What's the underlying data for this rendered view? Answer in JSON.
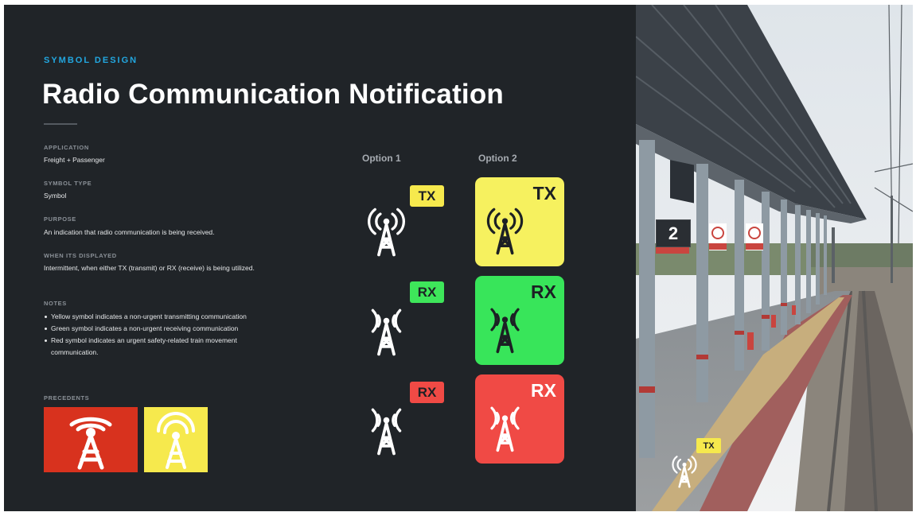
{
  "header": {
    "eyebrow": "SYMBOL DESIGN",
    "title": "Radio Communication Notification"
  },
  "details": {
    "application": {
      "label": "APPLICATION",
      "value": "Freight + Passenger"
    },
    "symbol_type": {
      "label": "SYMBOL TYPE",
      "value": "Symbol"
    },
    "purpose": {
      "label": "PURPOSE",
      "value": "An indication that radio communication is being received."
    },
    "when_displayed": {
      "label": "WHEN ITS DISPLAYED",
      "value": "Intermittent, when either TX (transmit) or RX (receive) is being utilized."
    },
    "notes": {
      "label": "NOTES",
      "items": [
        "Yellow symbol indicates a non-urgent transmitting communication",
        "Green symbol indicates a non-urgent receiving communication",
        "Red symbol indicates an urgent safety-related train movement communication."
      ]
    },
    "precedents": {
      "label": "PRECEDENTS",
      "items": [
        {
          "icon": "radio-tower-broadcast-icon",
          "background": "#d8321e",
          "foreground": "#ffffff"
        },
        {
          "icon": "radio-tower-broadcast-icon",
          "background": "#f6e94d",
          "foreground": "#ffffff"
        }
      ]
    }
  },
  "options": {
    "option1": {
      "label": "Option 1",
      "rows": [
        {
          "tag": "TX",
          "tag_color": "#f6e94d",
          "icon": "radio-tower-transmit-icon"
        },
        {
          "tag": "RX",
          "tag_color": "#3ee65a",
          "icon": "radio-tower-receive-icon"
        },
        {
          "tag": "RX",
          "tag_color": "#f04a45",
          "icon": "radio-tower-receive-icon"
        }
      ]
    },
    "option2": {
      "label": "Option 2",
      "rows": [
        {
          "tag": "TX",
          "tile_color": "#f6f15f",
          "text_color": "#1c2024",
          "icon": "radio-tower-transmit-icon"
        },
        {
          "tag": "RX",
          "tile_color": "#38e55a",
          "text_color": "#1c2024",
          "icon": "radio-tower-receive-icon"
        },
        {
          "tag": "RX",
          "tile_color": "#f04a45",
          "text_color": "#ffffff",
          "icon": "radio-tower-receive-icon"
        }
      ]
    }
  },
  "photo": {
    "platform_number": "2",
    "overlay_tag": "TX",
    "overlay_icon": "radio-tower-transmit-icon"
  }
}
